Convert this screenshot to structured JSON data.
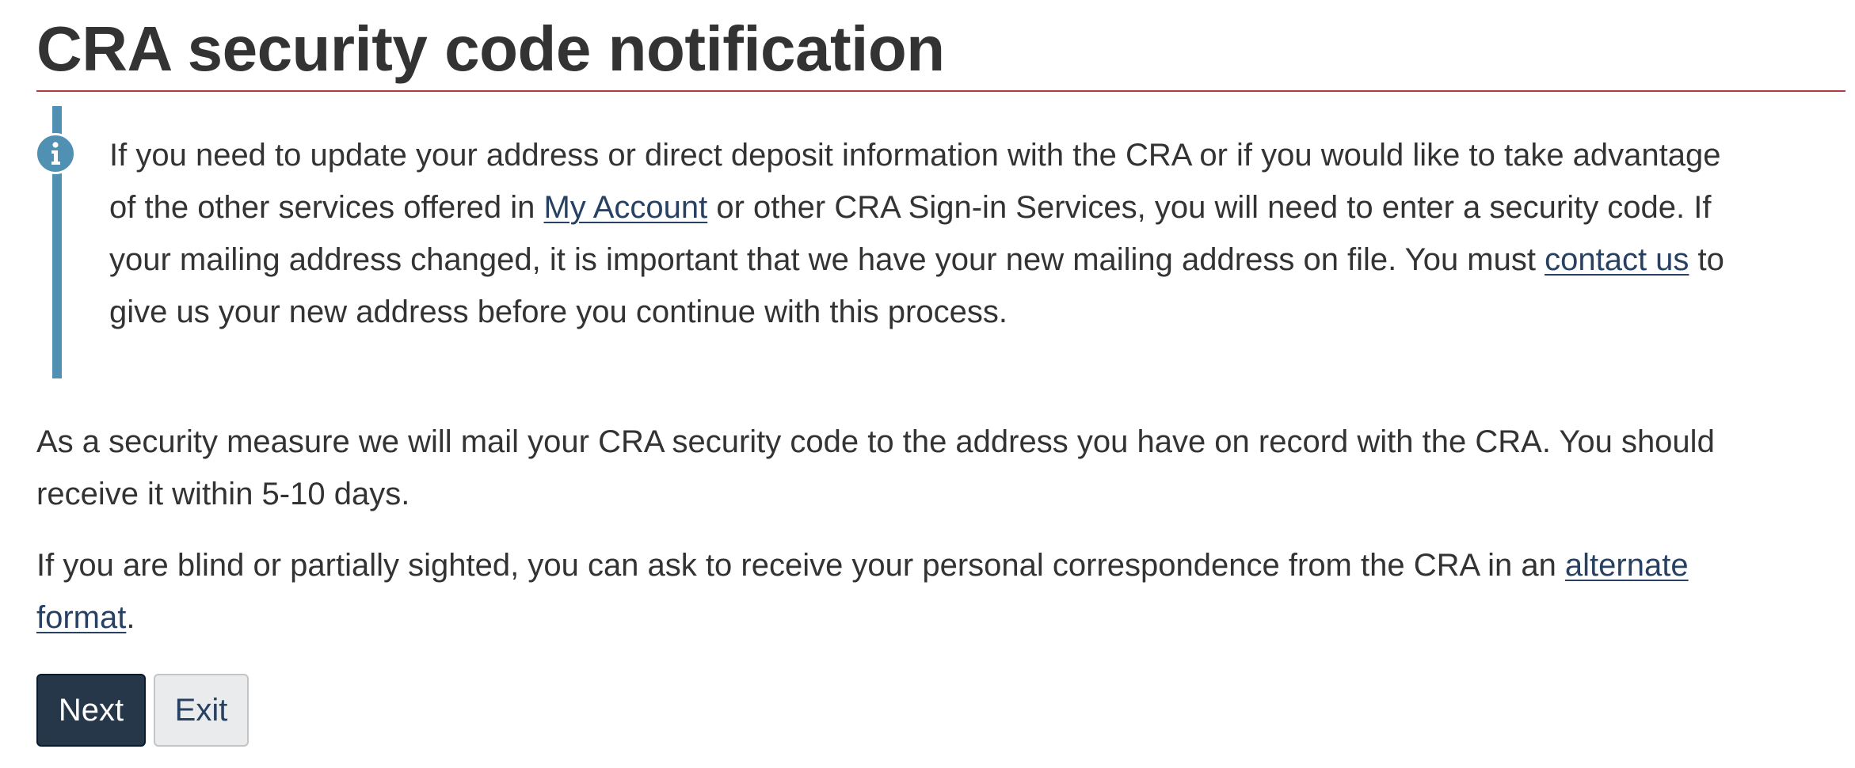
{
  "page": {
    "title": "CRA security code notification"
  },
  "alert": {
    "icon": "info-icon",
    "line1": "If you need to update your address or direct deposit information with the CRA or if you would like to take advantage",
    "line2_before": "of the other services offered in ",
    "line2_link": "My Account",
    "line2_after": " or other CRA Sign-in Services, you will need to enter a security code. If",
    "line3_before": "your mailing address changed, it is important that we have your new mailing address on file. You must ",
    "line3_link": "contact us",
    "line3_after": " to",
    "line4": "give us your new address before you continue with this process."
  },
  "body": {
    "p1_line1": "As a security measure we will mail your CRA security code to the address you have on record with the CRA. You should",
    "p1_line2": "receive it within 5-10 days.",
    "p2_line1_before": "If you are blind or partially sighted, you can ask to receive your personal correspondence from the CRA in an ",
    "p2_line1_link": "alternate",
    "p2_line2_link": "format",
    "p2_line2_after": "."
  },
  "buttons": {
    "next": "Next",
    "exit": "Exit"
  },
  "colors": {
    "title_rule": "#af3c43",
    "alert_accent": "#5091b3",
    "link": "#284162",
    "primary_button": "#26374a",
    "default_button": "#eaebed"
  }
}
